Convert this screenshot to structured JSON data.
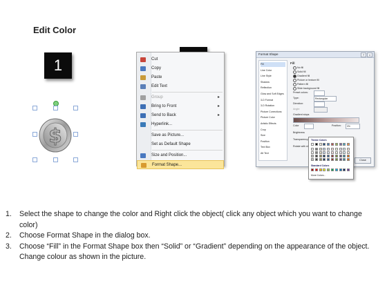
{
  "page": {
    "title": "Edit Color",
    "steps": [
      "1",
      "2",
      "3"
    ]
  },
  "coin": {
    "icon": "dollar-coin-icon"
  },
  "context_menu": {
    "items": [
      {
        "label": "Cut",
        "icon": "scissors-icon",
        "color": "#c8453a",
        "disabled": false,
        "submenu": false
      },
      {
        "label": "Copy",
        "icon": "copy-icon",
        "color": "#4a79c0",
        "disabled": false,
        "submenu": false
      },
      {
        "label": "Paste",
        "icon": "paste-icon",
        "color": "#c89a3a",
        "disabled": false,
        "submenu": false
      },
      {
        "label": "Edit Text",
        "icon": "edit-text-icon",
        "color": "#5a7fb8",
        "disabled": false,
        "submenu": false
      },
      {
        "label": "Group",
        "icon": "group-icon",
        "color": "#a0a0a0",
        "disabled": true,
        "submenu": true
      },
      {
        "label": "Bring to Front",
        "icon": "bring-front-icon",
        "color": "#3d6fb5",
        "disabled": false,
        "submenu": true
      },
      {
        "label": "Send to Back",
        "icon": "send-back-icon",
        "color": "#3d6fb5",
        "disabled": false,
        "submenu": true
      },
      {
        "label": "Hyperlink...",
        "icon": "globe-link-icon",
        "color": "#3a7ab8",
        "disabled": false,
        "submenu": false
      },
      {
        "label": "Save as Picture...",
        "icon": "",
        "color": "",
        "disabled": false,
        "submenu": false
      },
      {
        "label": "Set as Default Shape",
        "icon": "",
        "color": "",
        "disabled": false,
        "submenu": false
      },
      {
        "label": "Size and Position...",
        "icon": "size-position-icon",
        "color": "#4a79c0",
        "disabled": false,
        "submenu": false
      },
      {
        "label": "Format Shape...",
        "icon": "format-shape-icon",
        "color": "#d89a30",
        "disabled": false,
        "submenu": false,
        "highlighted": true
      }
    ]
  },
  "format_dialog": {
    "title": "Format Shape",
    "nav_items": [
      "Fill",
      "Line Color",
      "Line Style",
      "Shadow",
      "Reflection",
      "Glow and Soft Edges",
      "3-D Format",
      "3-D Rotation",
      "Picture Corrections",
      "Picture Color",
      "Artistic Effects",
      "Crop",
      "Size",
      "Position",
      "Text Box",
      "Alt Text"
    ],
    "section_heading": "Fill",
    "fill_options": [
      {
        "label": "No fill",
        "selected": false
      },
      {
        "label": "Solid fill",
        "selected": false
      },
      {
        "label": "Gradient fill",
        "selected": true
      },
      {
        "label": "Picture or texture fill",
        "selected": false
      },
      {
        "label": "Pattern fill",
        "selected": false
      },
      {
        "label": "Slide background fill",
        "selected": false
      }
    ],
    "labels": {
      "preset_colors": "Preset colors:",
      "type": "Type:",
      "type_value": "Rectangular",
      "direction": "Direction:",
      "angle": "Angle:",
      "gradient_stops": "Gradient stops",
      "color": "Color",
      "position": "Position:",
      "position_value": "0%",
      "brightness": "Brightness",
      "transparency": "Transparency",
      "rotate": "Rotate with shape",
      "close": "Close"
    }
  },
  "palette": {
    "theme_label": "Theme Colors",
    "standard_label": "Standard Colors",
    "more_label": "More Colors...",
    "theme_top": [
      "#ffffff",
      "#000000",
      "#eeece1",
      "#1f497d",
      "#4f81bd",
      "#c0504d",
      "#9bbb59",
      "#8064a2",
      "#4bacc6",
      "#f79646"
    ],
    "theme_tints": [
      "#f2f2f2",
      "#7f7f7f",
      "#ddd9c3",
      "#c6d9f0",
      "#dbe5f1",
      "#f2dcdb",
      "#ebf1dd",
      "#e5e0ec",
      "#dbeef3",
      "#fdeada"
    ],
    "theme_shades": [
      "#bfbfbf",
      "#404040",
      "#948a54",
      "#17365d",
      "#366092",
      "#953734",
      "#76923c",
      "#5f497a",
      "#31859b",
      "#e36c09"
    ],
    "standard": [
      "#c00000",
      "#ff0000",
      "#ffc000",
      "#ffff00",
      "#92d050",
      "#00b050",
      "#00b0f0",
      "#0070c0",
      "#002060",
      "#7030a0"
    ]
  },
  "instructions": [
    {
      "num": "1.",
      "text": "Select the shape to change the color and Right click the object( click any object which you want to change color)"
    },
    {
      "num": "2.",
      "text": "Choose Format Shape in the dialog box."
    },
    {
      "num": "3.",
      "text": "Choose “Fill” in the Format Shape box then “Solid” or “Gradient” depending on the appearance of the object. Change colour as shown in the picture."
    }
  ]
}
